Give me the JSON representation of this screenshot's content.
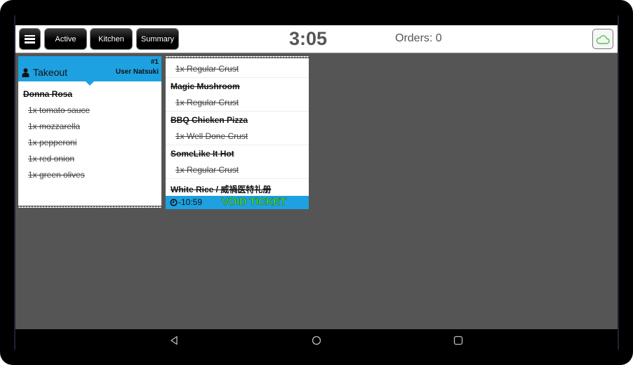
{
  "topbar": {
    "menu_icon": "hamburger-menu-icon",
    "buttons": [
      {
        "label": "Active"
      },
      {
        "label": "Kitchen"
      },
      {
        "label": "Summary"
      }
    ],
    "clock": "3:05",
    "orders": "Orders: 0",
    "cloud_icon": "cloud-icon",
    "cloud_color": "#4cc552"
  },
  "tickets": [
    {
      "type": "Takeout",
      "number": "#1",
      "user": "User Natsuki",
      "header_color": "#1da1e1",
      "items": [
        {
          "name": "Donna Rosa",
          "mods": [
            "1x tomato sauce",
            "1x mozzarella",
            "1x pepperoni",
            "1x red onion",
            "1x green olives"
          ]
        }
      ]
    },
    {
      "items": [
        {
          "name": "",
          "mods": [
            "1x Regular Crust"
          ]
        },
        {
          "name": "Magic Mushroom",
          "mods": [
            "1x Regular Crust"
          ]
        },
        {
          "name": "BBQ Chicken Pizza",
          "mods": [
            "1x Well Done Crust"
          ]
        },
        {
          "name": "SomeLike It Hot",
          "mods": [
            "1x Regular Crust"
          ]
        },
        {
          "name": "White Rice / 威禍医特礼册",
          "mods": []
        }
      ],
      "timer": "-10:59",
      "status": "VOID TICKET",
      "status_color": "#4ddc56"
    }
  ],
  "navbar": {
    "back_icon": "back-triangle-icon",
    "home_icon": "home-circle-icon",
    "recents_icon": "recents-square-icon"
  }
}
